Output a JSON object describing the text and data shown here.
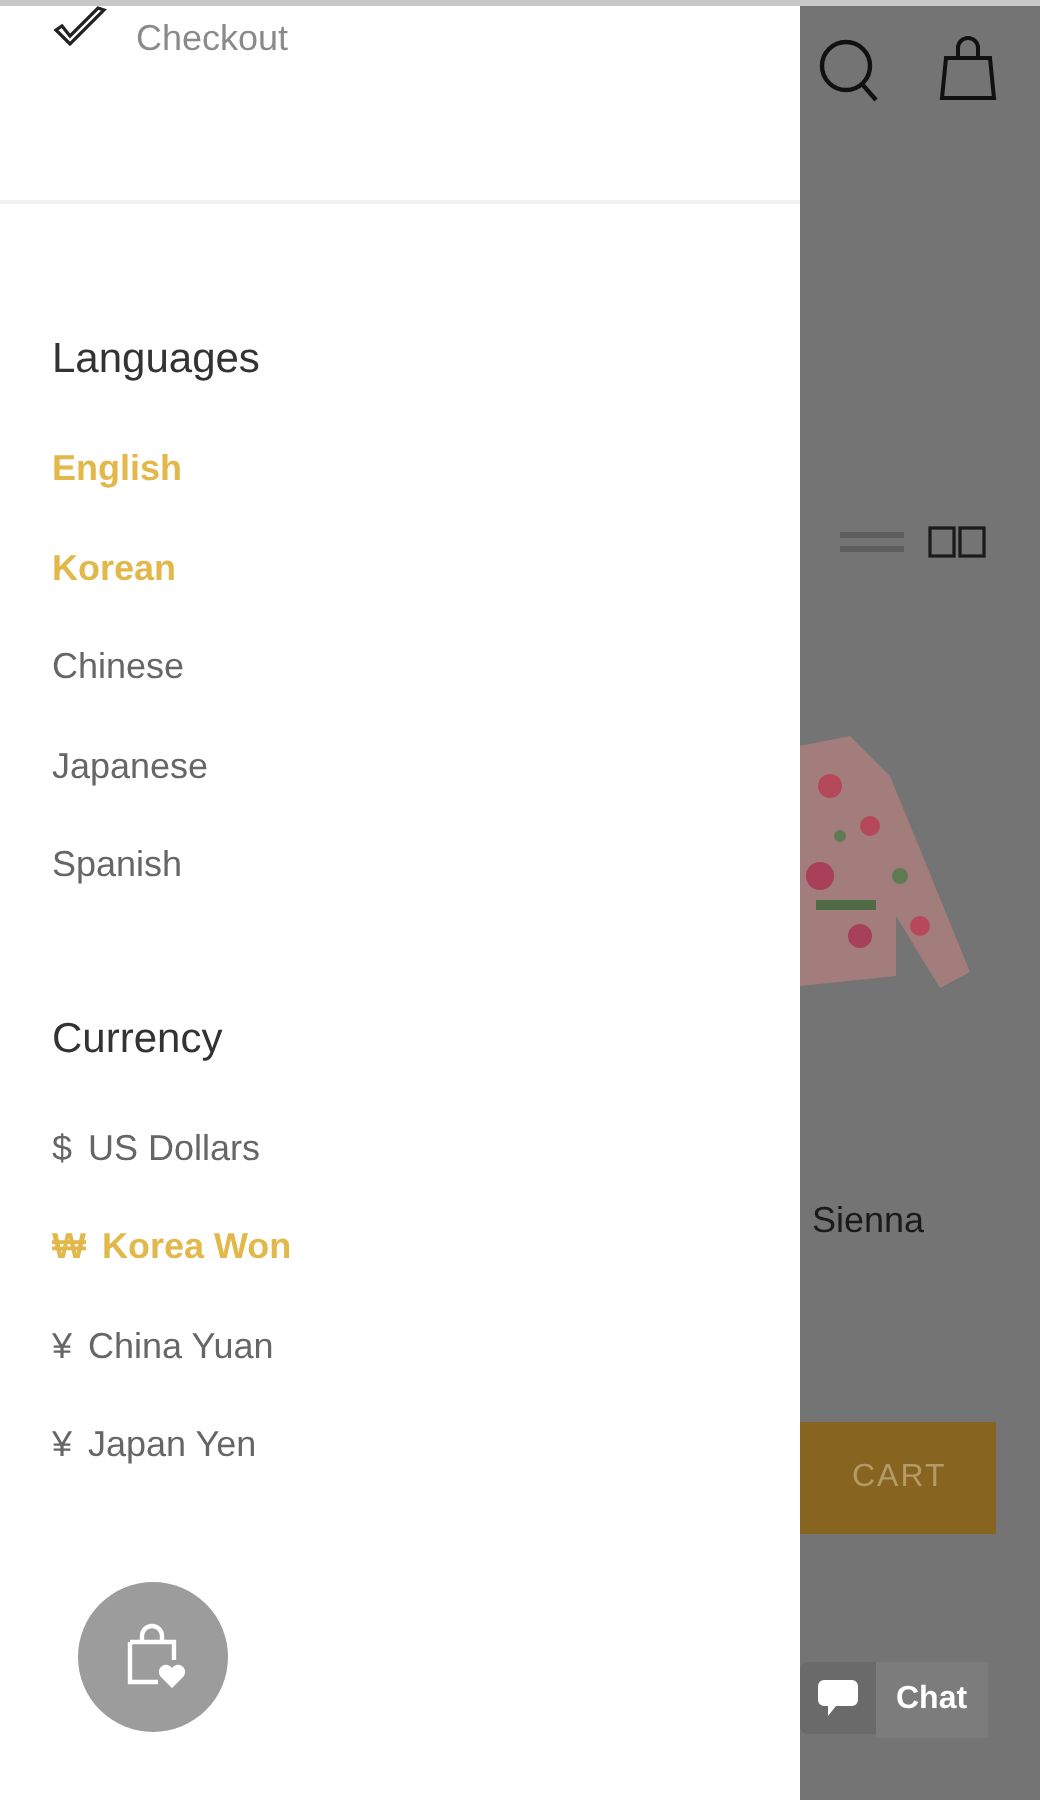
{
  "drawer": {
    "checkout": {
      "label": "Checkout"
    },
    "languages": {
      "title": "Languages",
      "items": [
        {
          "label": "English",
          "selected": true
        },
        {
          "label": "Korean",
          "selected": true
        },
        {
          "label": "Chinese",
          "selected": false
        },
        {
          "label": "Japanese",
          "selected": false
        },
        {
          "label": "Spanish",
          "selected": false
        }
      ]
    },
    "currency": {
      "title": "Currency",
      "items": [
        {
          "symbol": "$",
          "label": "US Dollars",
          "selected": false
        },
        {
          "symbol": "₩",
          "label": "Korea Won",
          "selected": true
        },
        {
          "symbol": "¥",
          "label": "China Yuan",
          "selected": false
        },
        {
          "symbol": "¥",
          "label": "Japan Yen",
          "selected": false
        }
      ]
    }
  },
  "background": {
    "product": {
      "kind": "picture",
      "name": "Sienna"
    },
    "cart_button": "CART"
  },
  "chat": {
    "label": "Chat"
  }
}
